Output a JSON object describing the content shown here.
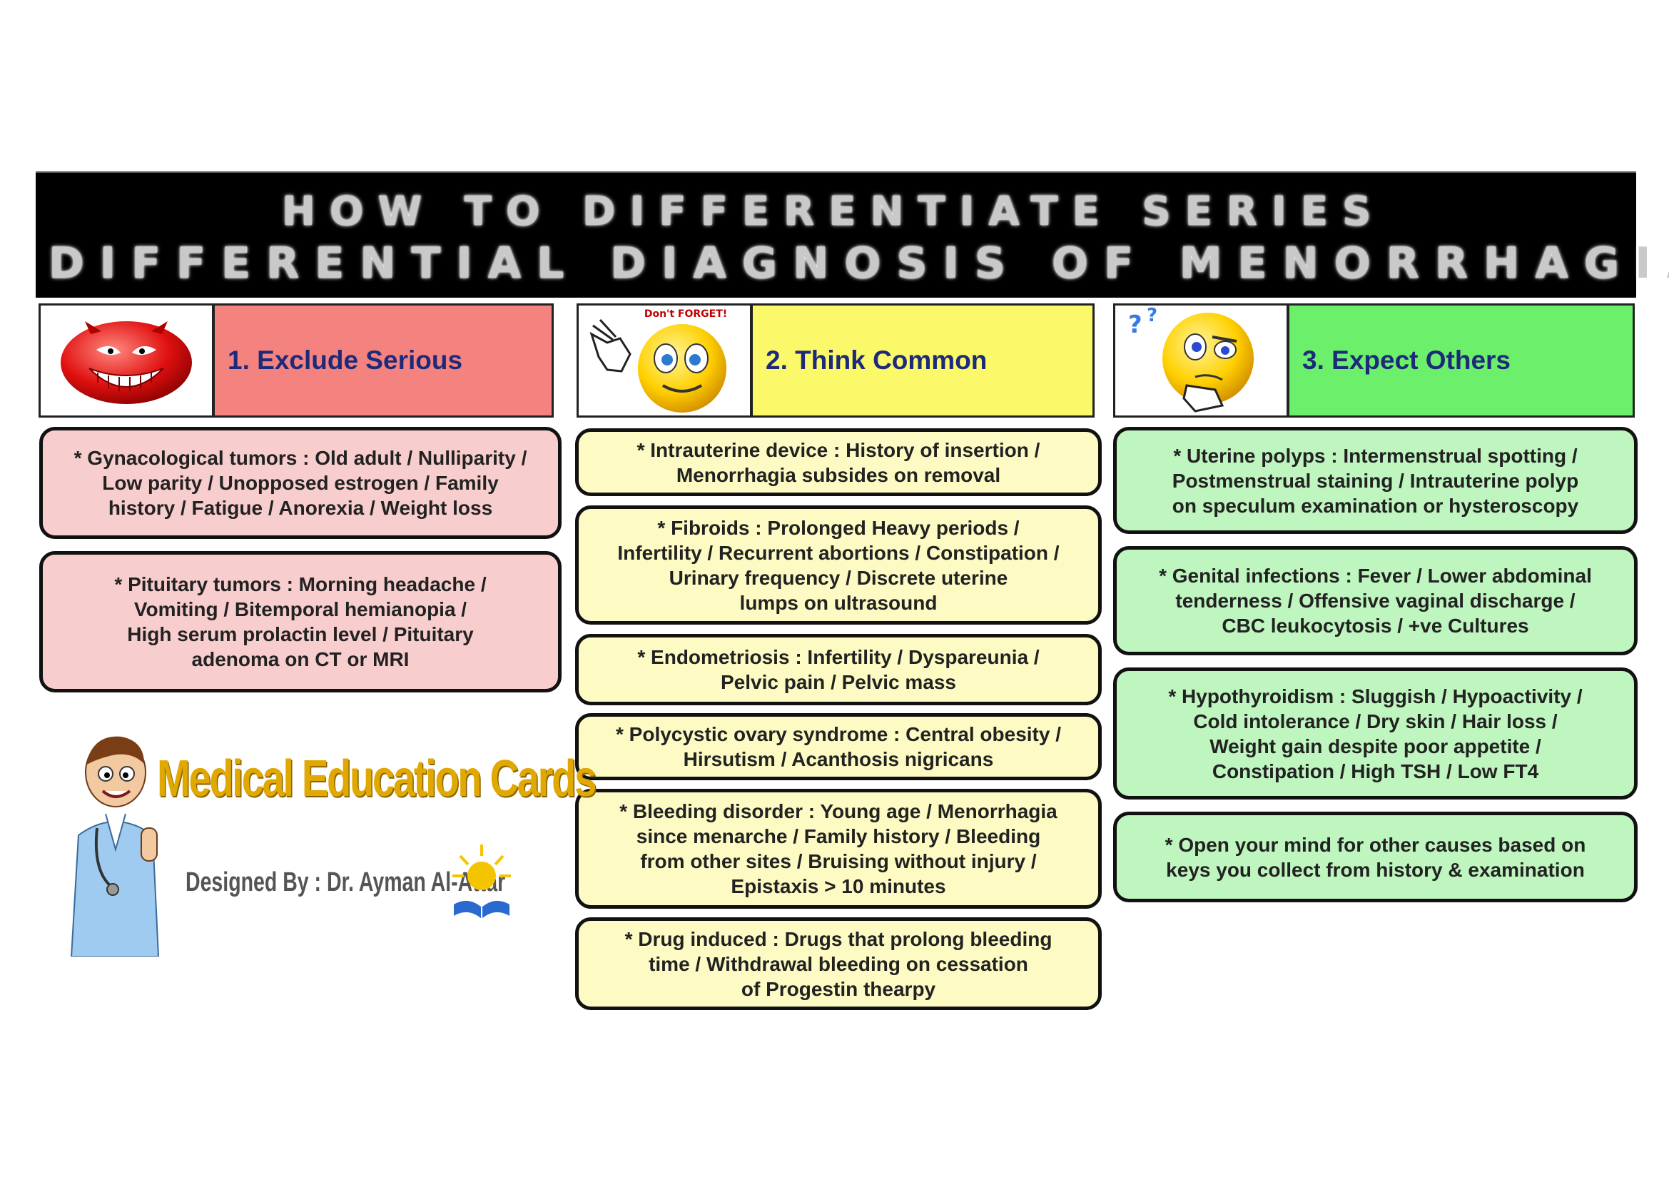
{
  "banner": {
    "line1": "HOW TO DIFFERENTIATE SERIES",
    "line2": "DIFFERENTIAL DIAGNOSIS OF MENORRHAGIA"
  },
  "columns": [
    {
      "title": "1. Exclude Serious",
      "icon": "devil-smiley-icon",
      "color": "#f48380"
    },
    {
      "title": "2. Think Common",
      "icon": "dont-forget-smiley-icon",
      "icon_text": "Don't FORGET!",
      "color": "#fbf869"
    },
    {
      "title": "3. Expect Others",
      "icon": "thinking-smiley-icon",
      "color": "#6cf06c"
    }
  ],
  "serious": [
    "* Gynacological tumors : Old adult / Nulliparity /\nLow parity / Unopposed estrogen / Family\nhistory / Fatigue / Anorexia / Weight loss",
    "* Pituitary tumors : Morning headache /\nVomiting / Bitemporal hemianopia /\nHigh serum prolactin level / Pituitary\nadenoma on CT or MRI"
  ],
  "common": [
    "* Intrauterine device : History of insertion /\nMenorrhagia subsides on removal",
    "* Fibroids : Prolonged Heavy periods /\nInfertility / Recurrent abortions / Constipation /\nUrinary frequency / Discrete uterine\nlumps on ultrasound",
    "* Endometriosis : Infertility / Dyspareunia /\nPelvic pain / Pelvic mass",
    "* Polycystic ovary syndrome : Central obesity /\nHirsutism / Acanthosis nigricans",
    "* Bleeding disorder : Young age / Menorrhagia\nsince menarche / Family history / Bleeding\nfrom other sites / Bruising without injury /\nEpistaxis > 10 minutes",
    "* Drug induced : Drugs that prolong bleeding\ntime / Withdrawal bleeding on cessation\nof Progestin thearpy"
  ],
  "others": [
    "* Uterine polyps : Intermenstrual spotting /\nPostmenstrual staining / Intrauterine polyp\non speculum examination or hysteroscopy",
    "* Genital infections : Fever / Lower abdominal\ntenderness / Offensive vaginal discharge /\nCBC leukocytosis / +ve Cultures",
    "* Hypothyroidism : Sluggish / Hypoactivity /\nCold intolerance / Dry skin / Hair loss /\nWeight gain despite poor appetite /\nConstipation / High TSH / Low FT4",
    "* Open your mind for other causes based on\nkeys you collect from history & examination"
  ],
  "logo": {
    "title": "Medical Education Cards",
    "subtitle": "Designed By : Dr. Ayman Al-Attar"
  }
}
